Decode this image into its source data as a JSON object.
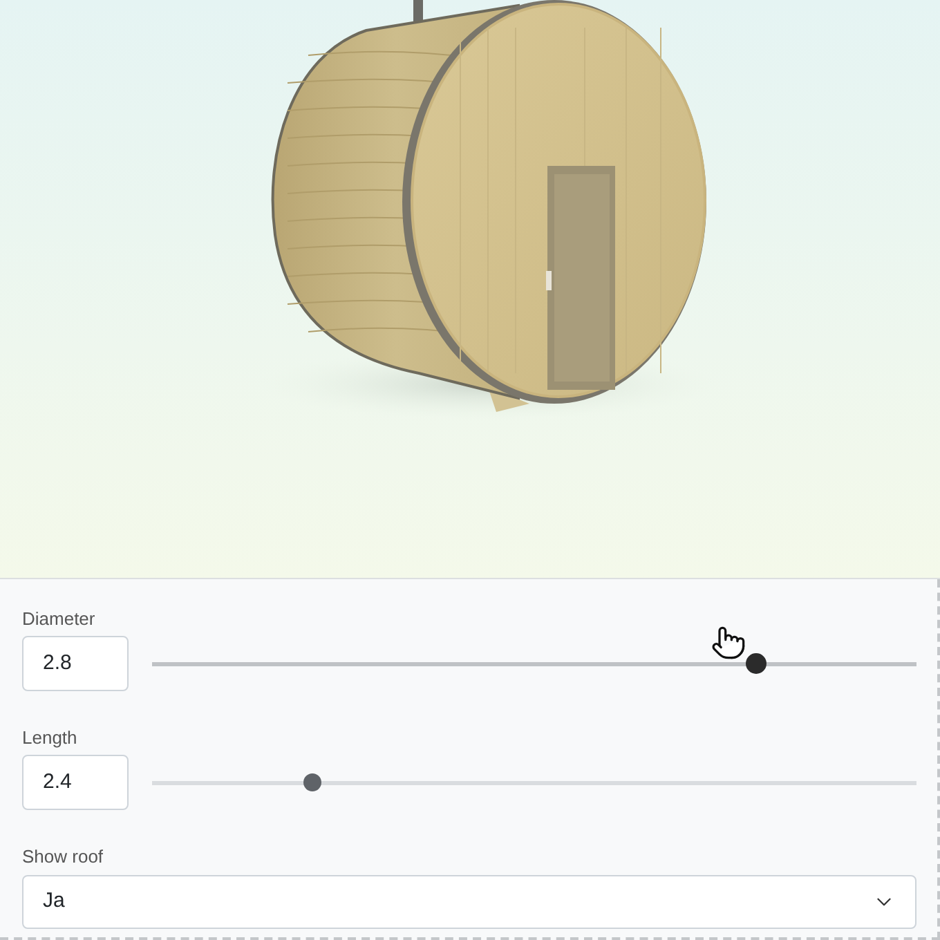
{
  "controls": [
    {
      "kind": "slider",
      "label": "Diameter",
      "value": "2.8",
      "level": 0.79,
      "active": true
    },
    {
      "kind": "slider",
      "label": "Length",
      "value": "2.4",
      "level": 0.21,
      "active": false
    },
    {
      "kind": "select",
      "label": "Show roof",
      "value": "Ja"
    }
  ]
}
